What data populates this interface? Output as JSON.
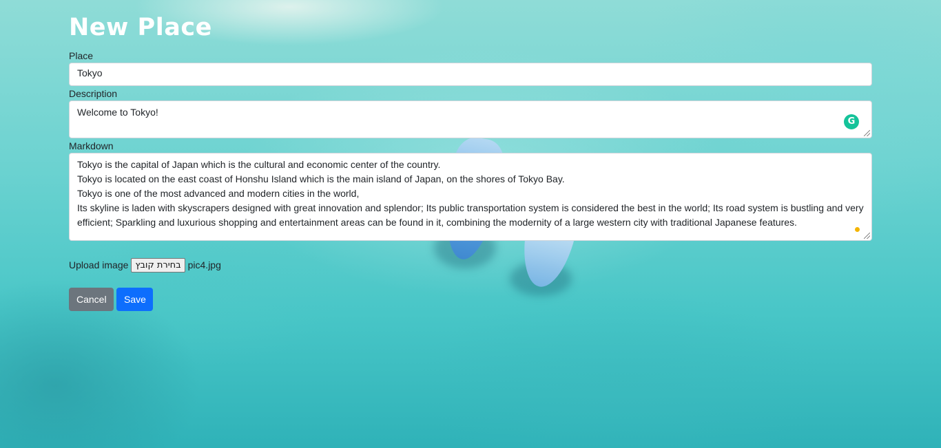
{
  "page": {
    "title": "New Place"
  },
  "form": {
    "place": {
      "label": "Place",
      "value": "Tokyo"
    },
    "description": {
      "label": "Description",
      "value": "Welcome to Tokyo!"
    },
    "markdown": {
      "label": "Markdown",
      "value": "Tokyo is the capital of Japan which is the cultural and economic center of the country.\nTokyo is located on the east coast of Honshu Island which is the main island of Japan, on the shores of Tokyo Bay.\nTokyo is one of the most advanced and modern cities in the world,\nIts skyline is laden with skyscrapers designed with great innovation and splendor; Its public transportation system is considered the best in the world; Its road system is bustling and very efficient; Sparkling and luxurious shopping and entertainment areas can be found in it, combining the modernity of a large western city with traditional Japanese features."
    },
    "upload": {
      "label": "Upload image",
      "button_label": "בחירת קובץ",
      "file_name": "pic4.jpg"
    },
    "buttons": {
      "cancel": "Cancel",
      "save": "Save"
    }
  },
  "icons": {
    "grammarly": "grammarly-icon",
    "grammarly_glyph": "G"
  },
  "colors": {
    "cancel_bg": "#6c757d",
    "save_bg": "#0d6efd",
    "grammarly": "#15c39a"
  }
}
